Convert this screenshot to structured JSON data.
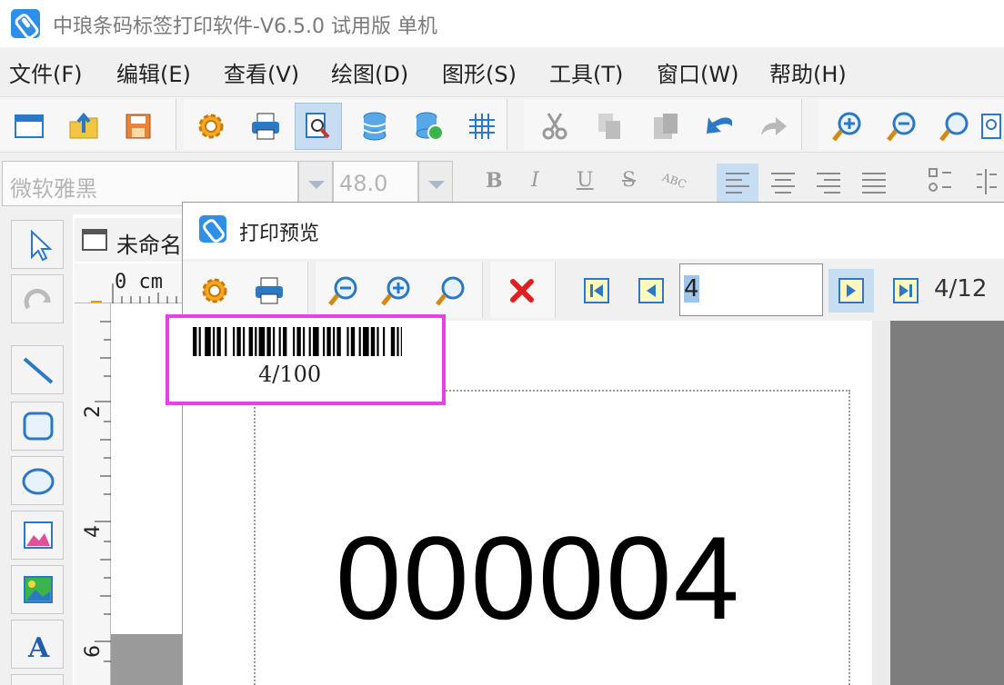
{
  "window": {
    "title": "中琅条码标签打印软件-V6.5.0 试用版 单机",
    "icon": "app-logo-icon",
    "brand_color": "#2f8fe6"
  },
  "menu": {
    "items": [
      {
        "label": "文件(F)"
      },
      {
        "label": "编辑(E)"
      },
      {
        "label": "查看(V)"
      },
      {
        "label": "绘图(D)"
      },
      {
        "label": "图形(S)"
      },
      {
        "label": "工具(T)"
      },
      {
        "label": "窗口(W)"
      },
      {
        "label": "帮助(H)"
      }
    ]
  },
  "toolbar": {
    "icons": [
      "new-window-icon",
      "open-icon",
      "save-icon",
      "settings-gear-icon",
      "print-icon",
      "print-preview-icon",
      "database-icon",
      "database-link-icon",
      "grid-icon",
      "cut-icon",
      "copy-icon",
      "paste-icon",
      "undo-icon",
      "redo-icon",
      "zoom-in-icon",
      "zoom-out-icon",
      "zoom-fit-icon",
      "more-icon"
    ],
    "active": "print-preview-icon"
  },
  "format_bar": {
    "font_name": "微软雅黑",
    "font_size": "48.0",
    "bold": "B",
    "italic": "I",
    "underline": "U",
    "strike": "S",
    "char_spacing": "ABC",
    "alignment": "left"
  },
  "document": {
    "tab_title": "未命名",
    "ruler_unit": "0 cm",
    "vertical_ticks": [
      "2",
      "4",
      "6"
    ]
  },
  "preview": {
    "title": "打印预览",
    "icon": "app-logo-icon",
    "current_page": "4",
    "page_count": "4/12",
    "label_number": "000004",
    "barcode_text": "4/100",
    "highlight_color": "#e640e6"
  }
}
